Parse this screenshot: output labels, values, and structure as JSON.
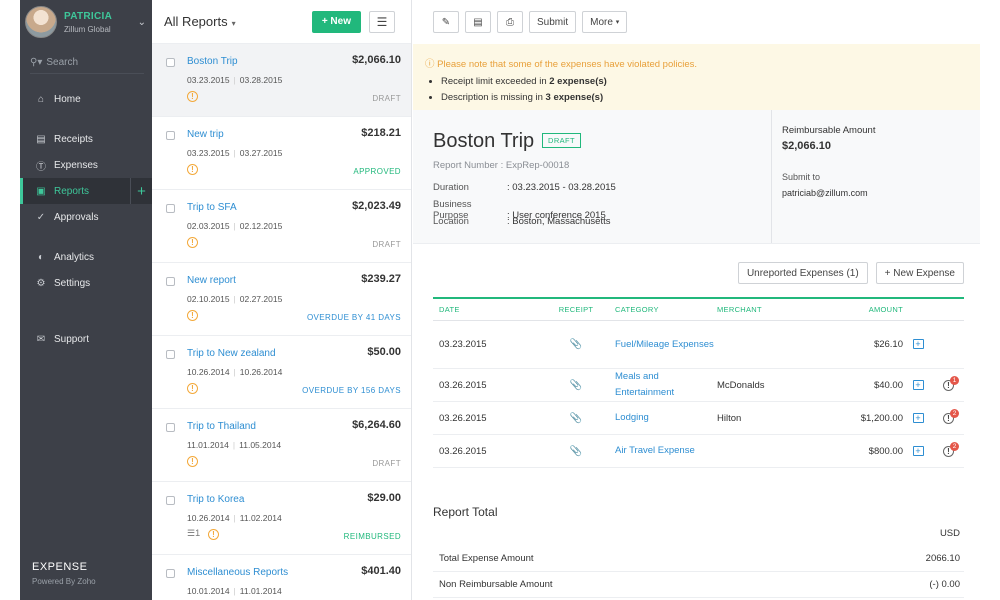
{
  "profile": {
    "name": "PATRICIA",
    "org": "Zillum Global"
  },
  "sidebar": {
    "search_placeholder": "Search",
    "items": [
      {
        "label": "Home",
        "icon": "home-icon"
      },
      {
        "label": "Receipts",
        "icon": "receipt-icon"
      },
      {
        "label": "Expenses",
        "icon": "dollar-icon"
      },
      {
        "label": "Reports",
        "icon": "folder-icon"
      },
      {
        "label": "Approvals",
        "icon": "check-icon"
      },
      {
        "label": "Analytics",
        "icon": "analytics-icon"
      },
      {
        "label": "Settings",
        "icon": "gear-icon"
      },
      {
        "label": "Support",
        "icon": "support-icon"
      }
    ],
    "active": "Reports",
    "app_name": "EXPENSE",
    "app_sub": "Powered By Zoho"
  },
  "list": {
    "title": "All Reports",
    "new_label": "+ New",
    "reports": [
      {
        "name": "Boston Trip",
        "amount": "$2,066.10",
        "from": "03.23.2015",
        "to": "03.28.2015",
        "status": "DRAFT"
      },
      {
        "name": "New trip",
        "amount": "$218.21",
        "from": "03.23.2015",
        "to": "03.27.2015",
        "status": "APPROVED"
      },
      {
        "name": "Trip to SFA",
        "amount": "$2,023.49",
        "from": "02.03.2015",
        "to": "02.12.2015",
        "status": "DRAFT"
      },
      {
        "name": "New report",
        "amount": "$239.27",
        "from": "02.10.2015",
        "to": "02.27.2015",
        "status": "OVERDUE BY 41 DAYS"
      },
      {
        "name": "Trip to New zealand",
        "amount": "$50.00",
        "from": "10.26.2014",
        "to": "10.26.2014",
        "status": "OVERDUE BY 156 DAYS"
      },
      {
        "name": "Trip to Thailand",
        "amount": "$6,264.60",
        "from": "11.01.2014",
        "to": "11.05.2014",
        "status": "DRAFT"
      },
      {
        "name": "Trip to Korea",
        "amount": "$29.00",
        "from": "10.26.2014",
        "to": "11.02.2014",
        "status": "REIMBURSED",
        "comments": "1"
      },
      {
        "name": "Miscellaneous Reports",
        "amount": "$401.40",
        "from": "10.01.2014",
        "to": "11.01.2014",
        "status": ""
      }
    ]
  },
  "toolbar": {
    "submit": "Submit",
    "more": "More"
  },
  "alert": {
    "title": "Please note that some of the expenses have violated policies.",
    "item1_pre": "Receipt limit exceeded in ",
    "item1_bold": "2 expense(s)",
    "item2_pre": "Description is missing in ",
    "item2_bold": "3 expense(s)"
  },
  "report": {
    "title": "Boston Trip",
    "status": "DRAFT",
    "number": "Report Number : ExpRep-00018",
    "duration_label": "Duration",
    "duration": ":  03.23.2015 - 03.28.2015",
    "purpose_label": "Business Purpose",
    "purpose": ":  User conference 2015",
    "location_label": "Location",
    "location": ":  Boston, Massachusetts",
    "reimb_label": "Reimbursable Amount",
    "reimb_amount": "$2,066.10",
    "submit_label": "Submit to",
    "submit_email": "patriciab@zillum.com"
  },
  "actions": {
    "unreported": "Unreported Expenses (1)",
    "new_expense": "+ New Expense"
  },
  "table": {
    "headers": {
      "date": "DATE",
      "receipt": "RECEIPT",
      "category": "CATEGORY",
      "merchant": "MERCHANT",
      "amount": "AMOUNT"
    },
    "rows": [
      {
        "date": "03.23.2015",
        "category": "Fuel/Mileage Expenses",
        "merchant": "",
        "amount": "$26.10",
        "violations": ""
      },
      {
        "date": "03.26.2015",
        "category": "Meals and Entertainment",
        "merchant": "McDonalds",
        "amount": "$40.00",
        "violations": "1"
      },
      {
        "date": "03.26.2015",
        "category": "Lodging",
        "merchant": "Hilton",
        "amount": "$1,200.00",
        "violations": "2"
      },
      {
        "date": "03.26.2015",
        "category": "Air Travel Expense",
        "merchant": "",
        "amount": "$800.00",
        "violations": "2"
      }
    ]
  },
  "totals": {
    "title": "Report Total",
    "currency": "USD",
    "rows": [
      {
        "label": "Total Expense Amount",
        "value": "2066.10"
      },
      {
        "label": "Non Reimbursable Amount",
        "value": "(-) 0.00"
      }
    ]
  },
  "colors": {
    "accent": "#21b87c",
    "link": "#2e8ed2",
    "warning": "#f3a93b",
    "sidebar": "#3d4048"
  }
}
